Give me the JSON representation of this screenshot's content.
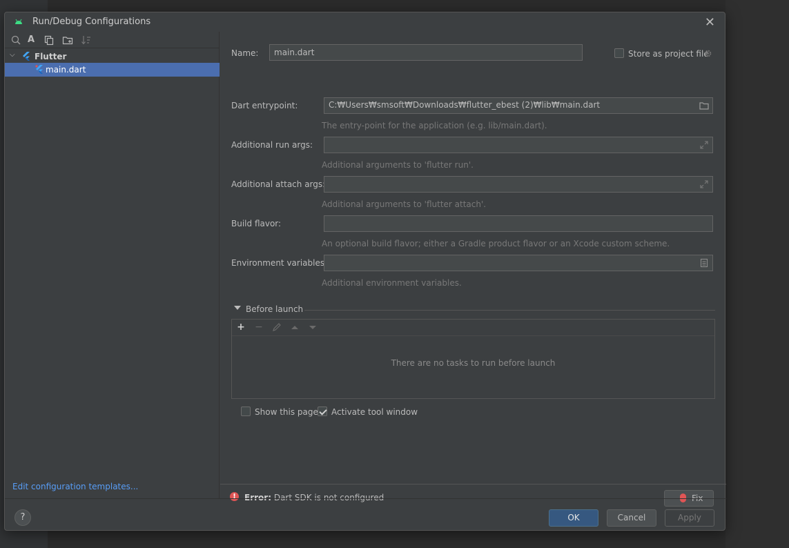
{
  "dialog": {
    "title": "Run/Debug Configurations",
    "close_label": "✕"
  },
  "tree": {
    "group_label": "Flutter",
    "item_label": "main.dart"
  },
  "left": {
    "edit_templates": "Edit configuration templates..."
  },
  "form": {
    "name_label": "Name:",
    "name_value": "main.dart",
    "store_label": "Store as project file",
    "entry_label": "Dart entrypoint:",
    "entry_value": "C:₩Users₩smsoft₩Downloads₩flutter_ebest (2)₩lib₩main.dart",
    "entry_hint": "The entry-point for the application (e.g. lib/main.dart).",
    "run_args_label": "Additional run args:",
    "run_args_hint": "Additional arguments to 'flutter run'.",
    "attach_args_label": "Additional attach args:",
    "attach_args_hint": "Additional arguments to 'flutter attach'.",
    "flavor_label": "Build flavor:",
    "flavor_hint": "An optional build flavor; either a Gradle product flavor or an Xcode custom scheme.",
    "env_label": "Environment variables:",
    "env_hint": "Additional environment variables."
  },
  "before_launch": {
    "title": "Before launch",
    "empty_text": "There are no tasks to run before launch",
    "add_label": "+",
    "remove_label": "−"
  },
  "options": {
    "show_page_label": "Show this page",
    "show_page_checked": false,
    "activate_label": "Activate tool window",
    "activate_checked": true
  },
  "error": {
    "prefix": "Error:",
    "message": "Dart SDK is not configured",
    "fix_label": "Fix"
  },
  "buttons": {
    "help": "?",
    "ok": "OK",
    "cancel": "Cancel",
    "apply": "Apply"
  },
  "colors": {
    "accent": "#4b6eaf",
    "link": "#589df6",
    "error": "#e05555",
    "flutter_blue": "#42a5f5"
  }
}
